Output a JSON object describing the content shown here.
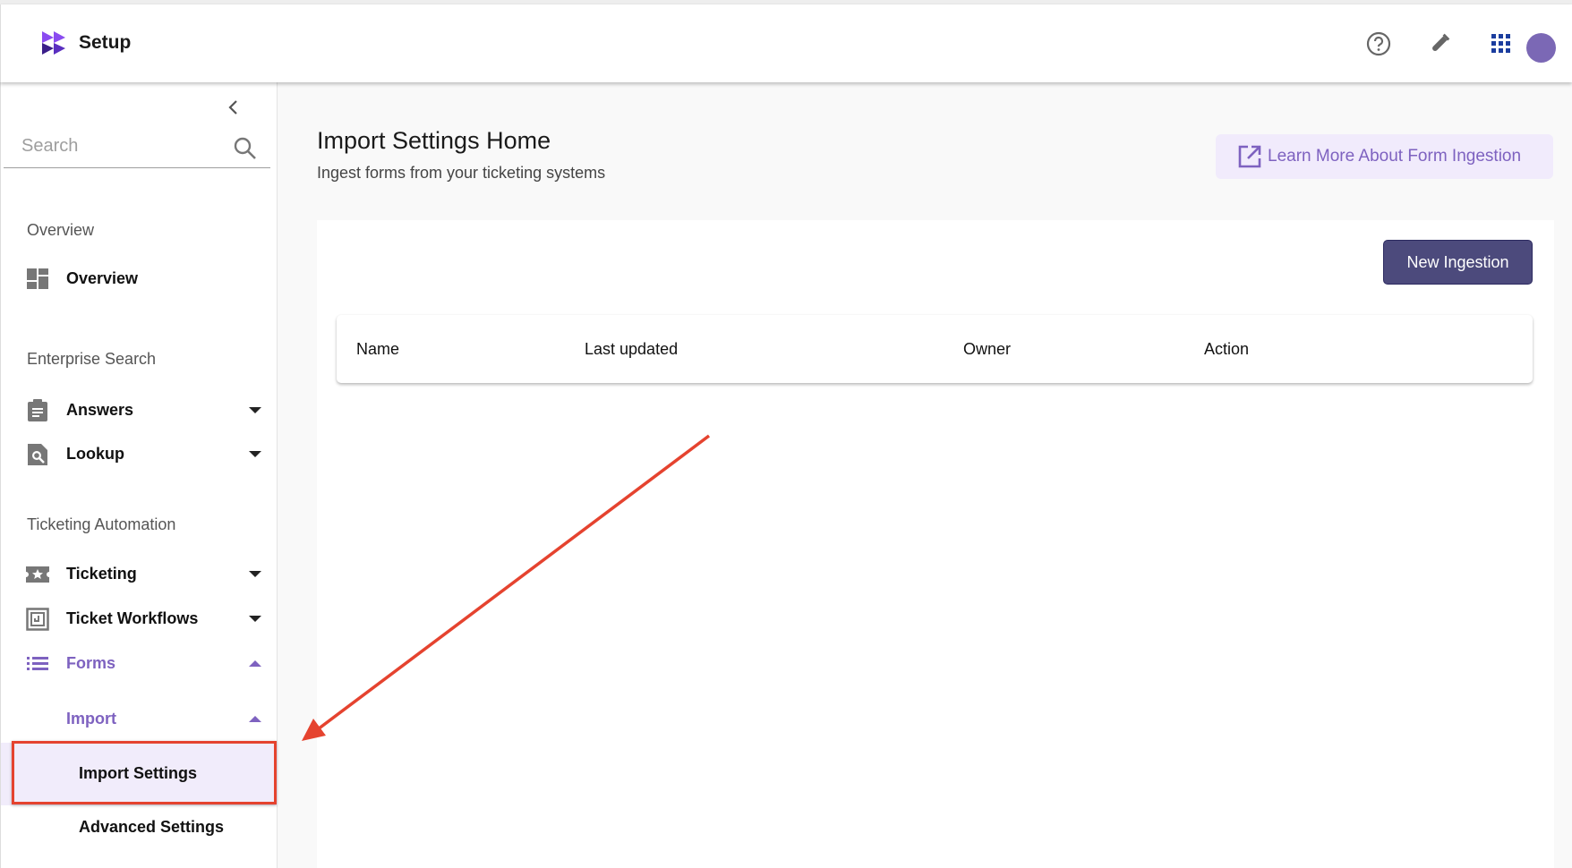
{
  "header": {
    "title": "Setup"
  },
  "sidebar": {
    "search_placeholder": "Search",
    "sections": {
      "overview": "Overview",
      "enterprise_search": "Enterprise Search",
      "ticketing_automation": "Ticketing Automation"
    },
    "items": {
      "overview": "Overview",
      "answers": "Answers",
      "lookup": "Lookup",
      "ticketing": "Ticketing",
      "ticket_workflows": "Ticket Workflows",
      "forms": "Forms",
      "import": "Import",
      "import_settings": "Import Settings",
      "advanced_settings": "Advanced Settings"
    }
  },
  "main": {
    "title": "Import Settings Home",
    "subtitle": "Ingest forms from your ticketing systems",
    "learn_more": "Learn More About Form Ingestion",
    "new_ingestion": "New Ingestion",
    "table": {
      "columns": [
        "Name",
        "Last updated",
        "Owner",
        "Action"
      ]
    }
  },
  "colors": {
    "accent": "#7e62c0",
    "button": "#4c4a7c",
    "annotation": "#e5432f"
  }
}
